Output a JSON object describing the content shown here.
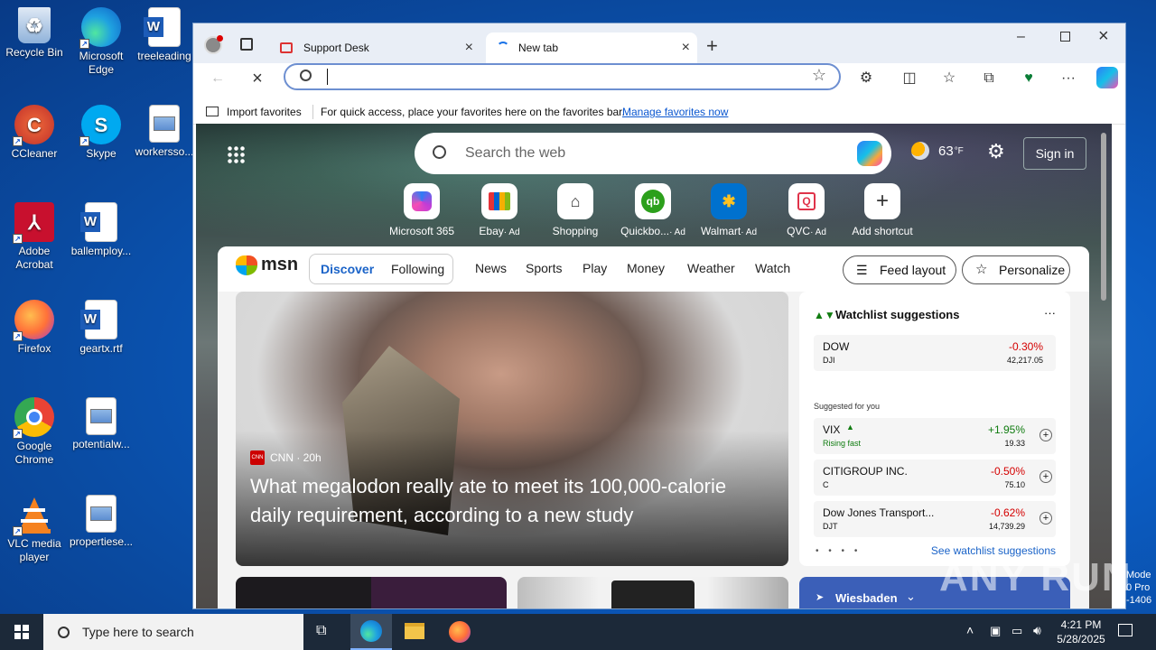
{
  "desktop": {
    "icons": [
      {
        "label": "Recycle Bin"
      },
      {
        "label": "Microsoft Edge"
      },
      {
        "label": "treeleading"
      },
      {
        "label": "CCleaner"
      },
      {
        "label": "Skype"
      },
      {
        "label": "workersso..."
      },
      {
        "label": "Adobe Acrobat"
      },
      {
        "label": "ballemploy..."
      },
      {
        "label": "Firefox"
      },
      {
        "label": "geartx.rtf"
      },
      {
        "label": "Google Chrome"
      },
      {
        "label": "potentialw..."
      },
      {
        "label": "VLC media player"
      },
      {
        "label": "propertiese..."
      }
    ],
    "watermark": "ANY RUN",
    "edge_text": [
      "Mode",
      "0 Pro",
      "-1406"
    ]
  },
  "browser": {
    "tabs": [
      {
        "label": "Support Desk"
      },
      {
        "label": "New tab"
      }
    ],
    "address_value": "",
    "favorites": {
      "import_label": "Import favorites",
      "hint": "For quick access, place your favorites here on the favorites bar.",
      "manage_link": "Manage favorites now"
    }
  },
  "ntp": {
    "search_placeholder": "Search the web",
    "weather": "63",
    "weather_unit": "°F",
    "sign_in": "Sign in",
    "quick_links": [
      {
        "label": "Microsoft 365",
        "ad": ""
      },
      {
        "label": "Ebay",
        "ad": "· Ad"
      },
      {
        "label": "Shopping",
        "ad": ""
      },
      {
        "label": "Quickbo...",
        "ad": "· Ad"
      },
      {
        "label": "Walmart",
        "ad": "· Ad"
      },
      {
        "label": "QVC",
        "ad": "· Ad"
      },
      {
        "label": "Add shortcut",
        "ad": ""
      }
    ],
    "nav": {
      "brand": "msn",
      "discover": "Discover",
      "following": "Following",
      "items": [
        "News",
        "Sports",
        "Play",
        "Money",
        "Weather",
        "Watch"
      ],
      "feed_layout": "Feed layout",
      "personalize": "Personalize"
    },
    "hero": {
      "source": "CNN",
      "time": "· 20h",
      "headline": "What megalodon really ate to meet its 100,000-calorie daily requirement, according to a new study"
    },
    "watchlist": {
      "title": "Watchlist suggestions",
      "more": "···",
      "dow": {
        "name": "DOW",
        "ticker": "DJI",
        "change": "-0.30%",
        "price": "42,217.05"
      },
      "suggested_label": "Suggested for you",
      "suggested": [
        {
          "name": "VIX",
          "ticker": "Rising fast",
          "change": "+1.95%",
          "price": "19.33",
          "up": true
        },
        {
          "name": "CITIGROUP INC.",
          "ticker": "C",
          "change": "-0.50%",
          "price": "75.10",
          "up": false
        },
        {
          "name": "Dow Jones Transport...",
          "ticker": "DJT",
          "change": "-0.62%",
          "price": "14,739.29",
          "up": false
        }
      ],
      "see_link": "See watchlist suggestions"
    },
    "weather_card": "Wiesbaden"
  },
  "taskbar": {
    "search_placeholder": "Type here to search",
    "time": "4:21 PM",
    "date": "5/28/2025"
  }
}
